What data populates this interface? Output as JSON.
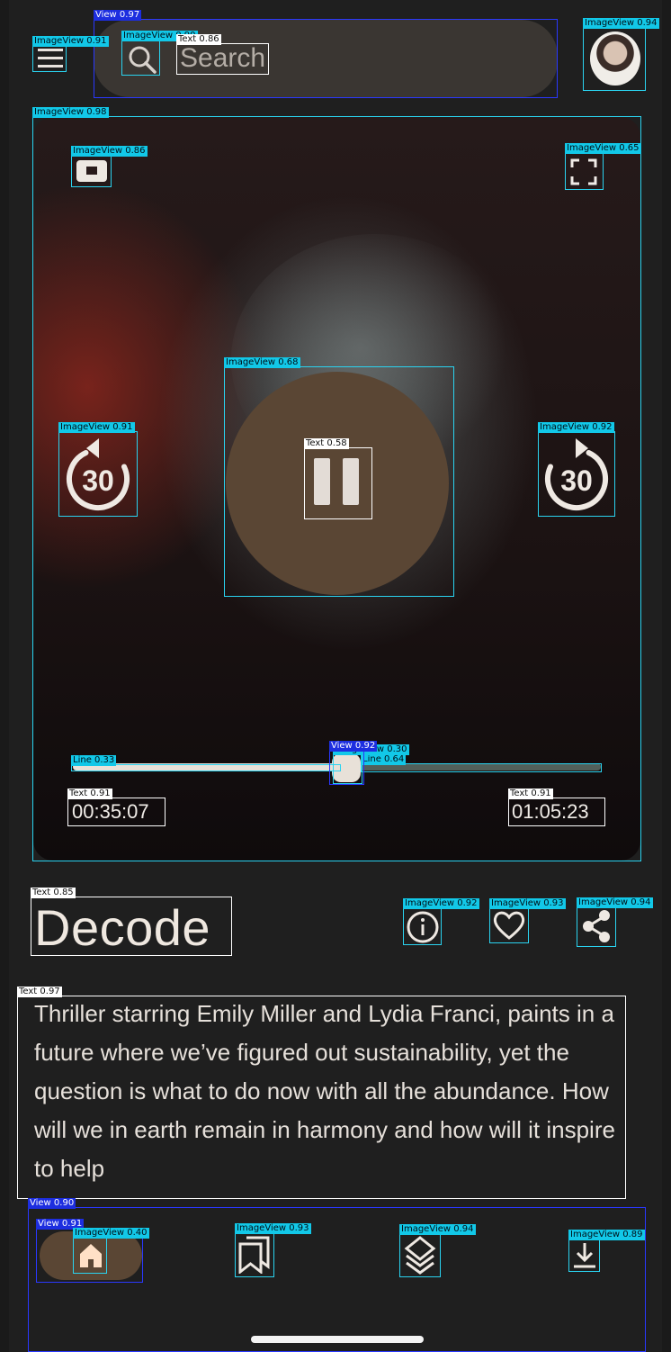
{
  "search": {
    "placeholder": "Search"
  },
  "player": {
    "elapsed": "00:35:07",
    "duration": "01:05:23",
    "progress_fraction": 0.52,
    "skip_back_seconds": "30",
    "skip_forward_seconds": "30"
  },
  "title": "Decode",
  "description": "Thriller starring Emily Miller and Lydia Franci, paints in a future where we’ve figured out sustainability, yet the question is what to do now with all the abundance. How will we in earth remain in harmony and how will it inspire to help",
  "nav": {
    "items": [
      {
        "name": "home",
        "icon": "home-icon",
        "active": true
      },
      {
        "name": "library",
        "icon": "bookmarks-icon",
        "active": false
      },
      {
        "name": "layers",
        "icon": "layers-icon",
        "active": false
      },
      {
        "name": "downloads",
        "icon": "download-icon",
        "active": false
      }
    ]
  },
  "overlay": {
    "view_097": "View 0.97",
    "imageview_091_menu": "ImageView 0.91",
    "imageview_090_search": "ImageView 0.90",
    "text_086": "Text 0.86",
    "imageview_094_avatar": "ImageView 0.94",
    "imageview_098_video": "ImageView 0.98",
    "imageview_086_pip": "ImageView 0.86",
    "imageview_065_fullscreen": "ImageView 0.65",
    "imageview_068_play": "ImageView 0.68",
    "text_058": "Text 0.58",
    "imageview_091_back": "ImageView 0.91",
    "imageview_092_fwd": "ImageView 0.92",
    "line_033": "Line 0.33",
    "view_092": "View 0.92",
    "imageview_030": "ImageView 0.30",
    "line_064": "Line 0.64",
    "text_091_left": "Text 0.91",
    "text_091_right": "Text 0.91",
    "text_085": "Text 0.85",
    "imageview_092_info": "ImageView 0.92",
    "imageview_093_heart": "ImageView 0.93",
    "imageview_094_share": "ImageView 0.94",
    "text_097": "Text 0.97",
    "view_090": "View 0.90",
    "view_091": "View 0.91",
    "imageview_040": "ImageView 0.40",
    "imageview_093_nav": "ImageView 0.93",
    "imageview_094_nav": "ImageView 0.94",
    "imageview_089_nav": "ImageView 0.89"
  },
  "colors": {
    "accent": "#5a4634",
    "background": "#1f1f1f",
    "overlay_cyan": "#2ad3f0",
    "overlay_blue": "#2a38ff"
  }
}
